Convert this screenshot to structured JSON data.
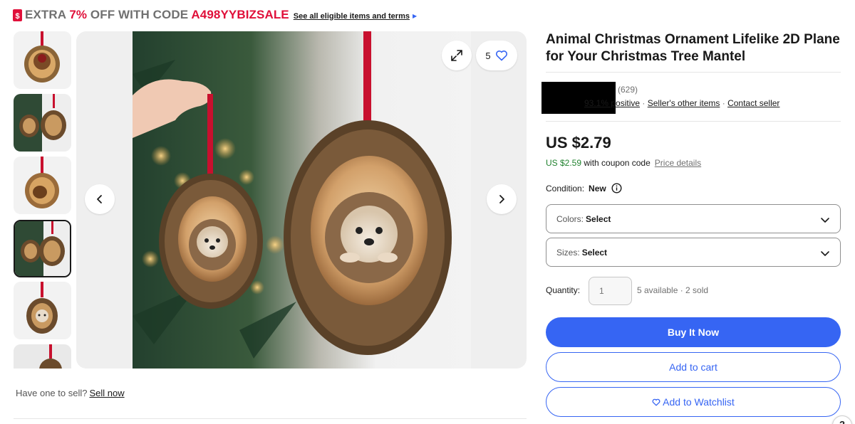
{
  "promo": {
    "prefix": "EXTRA ",
    "percent": "7%",
    "middle": " OFF WITH CODE ",
    "code": "A498YYBIZSALE",
    "link": "See all eligible items and terms",
    "icon": "coupon-tag-icon",
    "accent_color": "#e0103a"
  },
  "gallery": {
    "thumbnails": [
      {
        "icon": "ornament-thumb-icon"
      },
      {
        "icon": "ornament-pair-thumb-icon"
      },
      {
        "icon": "ornament-thumb-icon"
      },
      {
        "icon": "ornament-pair-thumb-icon",
        "selected": true
      },
      {
        "icon": "hedgehog-thumb-icon"
      },
      {
        "icon": "ornament-thumb-icon"
      }
    ],
    "watch_count": "5",
    "main_image": "hedgehog-ornament-photo"
  },
  "sell": {
    "text": "Have one to sell?",
    "link": "Sell now"
  },
  "product": {
    "title": "Animal Christmas Ornament Lifelike 2D Plane for Your Christmas Tree Mantel",
    "price": "US $2.79",
    "coupon_price": "US $2.59",
    "coupon_text": " with coupon code",
    "price_details": "Price details",
    "condition_label": "Condition:",
    "condition_value": "New"
  },
  "seller": {
    "feedback_count": "(629)",
    "positive": "93.1% positive",
    "sep": " · ",
    "other_items": "Seller's other items",
    "contact": "Contact seller"
  },
  "options": {
    "colors_label": "Colors:",
    "colors_value": "Select",
    "sizes_label": "Sizes:",
    "sizes_value": "Select"
  },
  "quantity": {
    "label": "Quantity:",
    "placeholder": "1",
    "availability": "5 available · 2 sold"
  },
  "actions": {
    "buy_now": "Buy It Now",
    "add_to_cart": "Add to cart",
    "add_to_watchlist": "Add to Watchlist"
  },
  "help": {
    "label": "?"
  },
  "colors": {
    "primary": "#3665f3",
    "coupon_green": "#21822f",
    "promo_red": "#e0103a"
  }
}
